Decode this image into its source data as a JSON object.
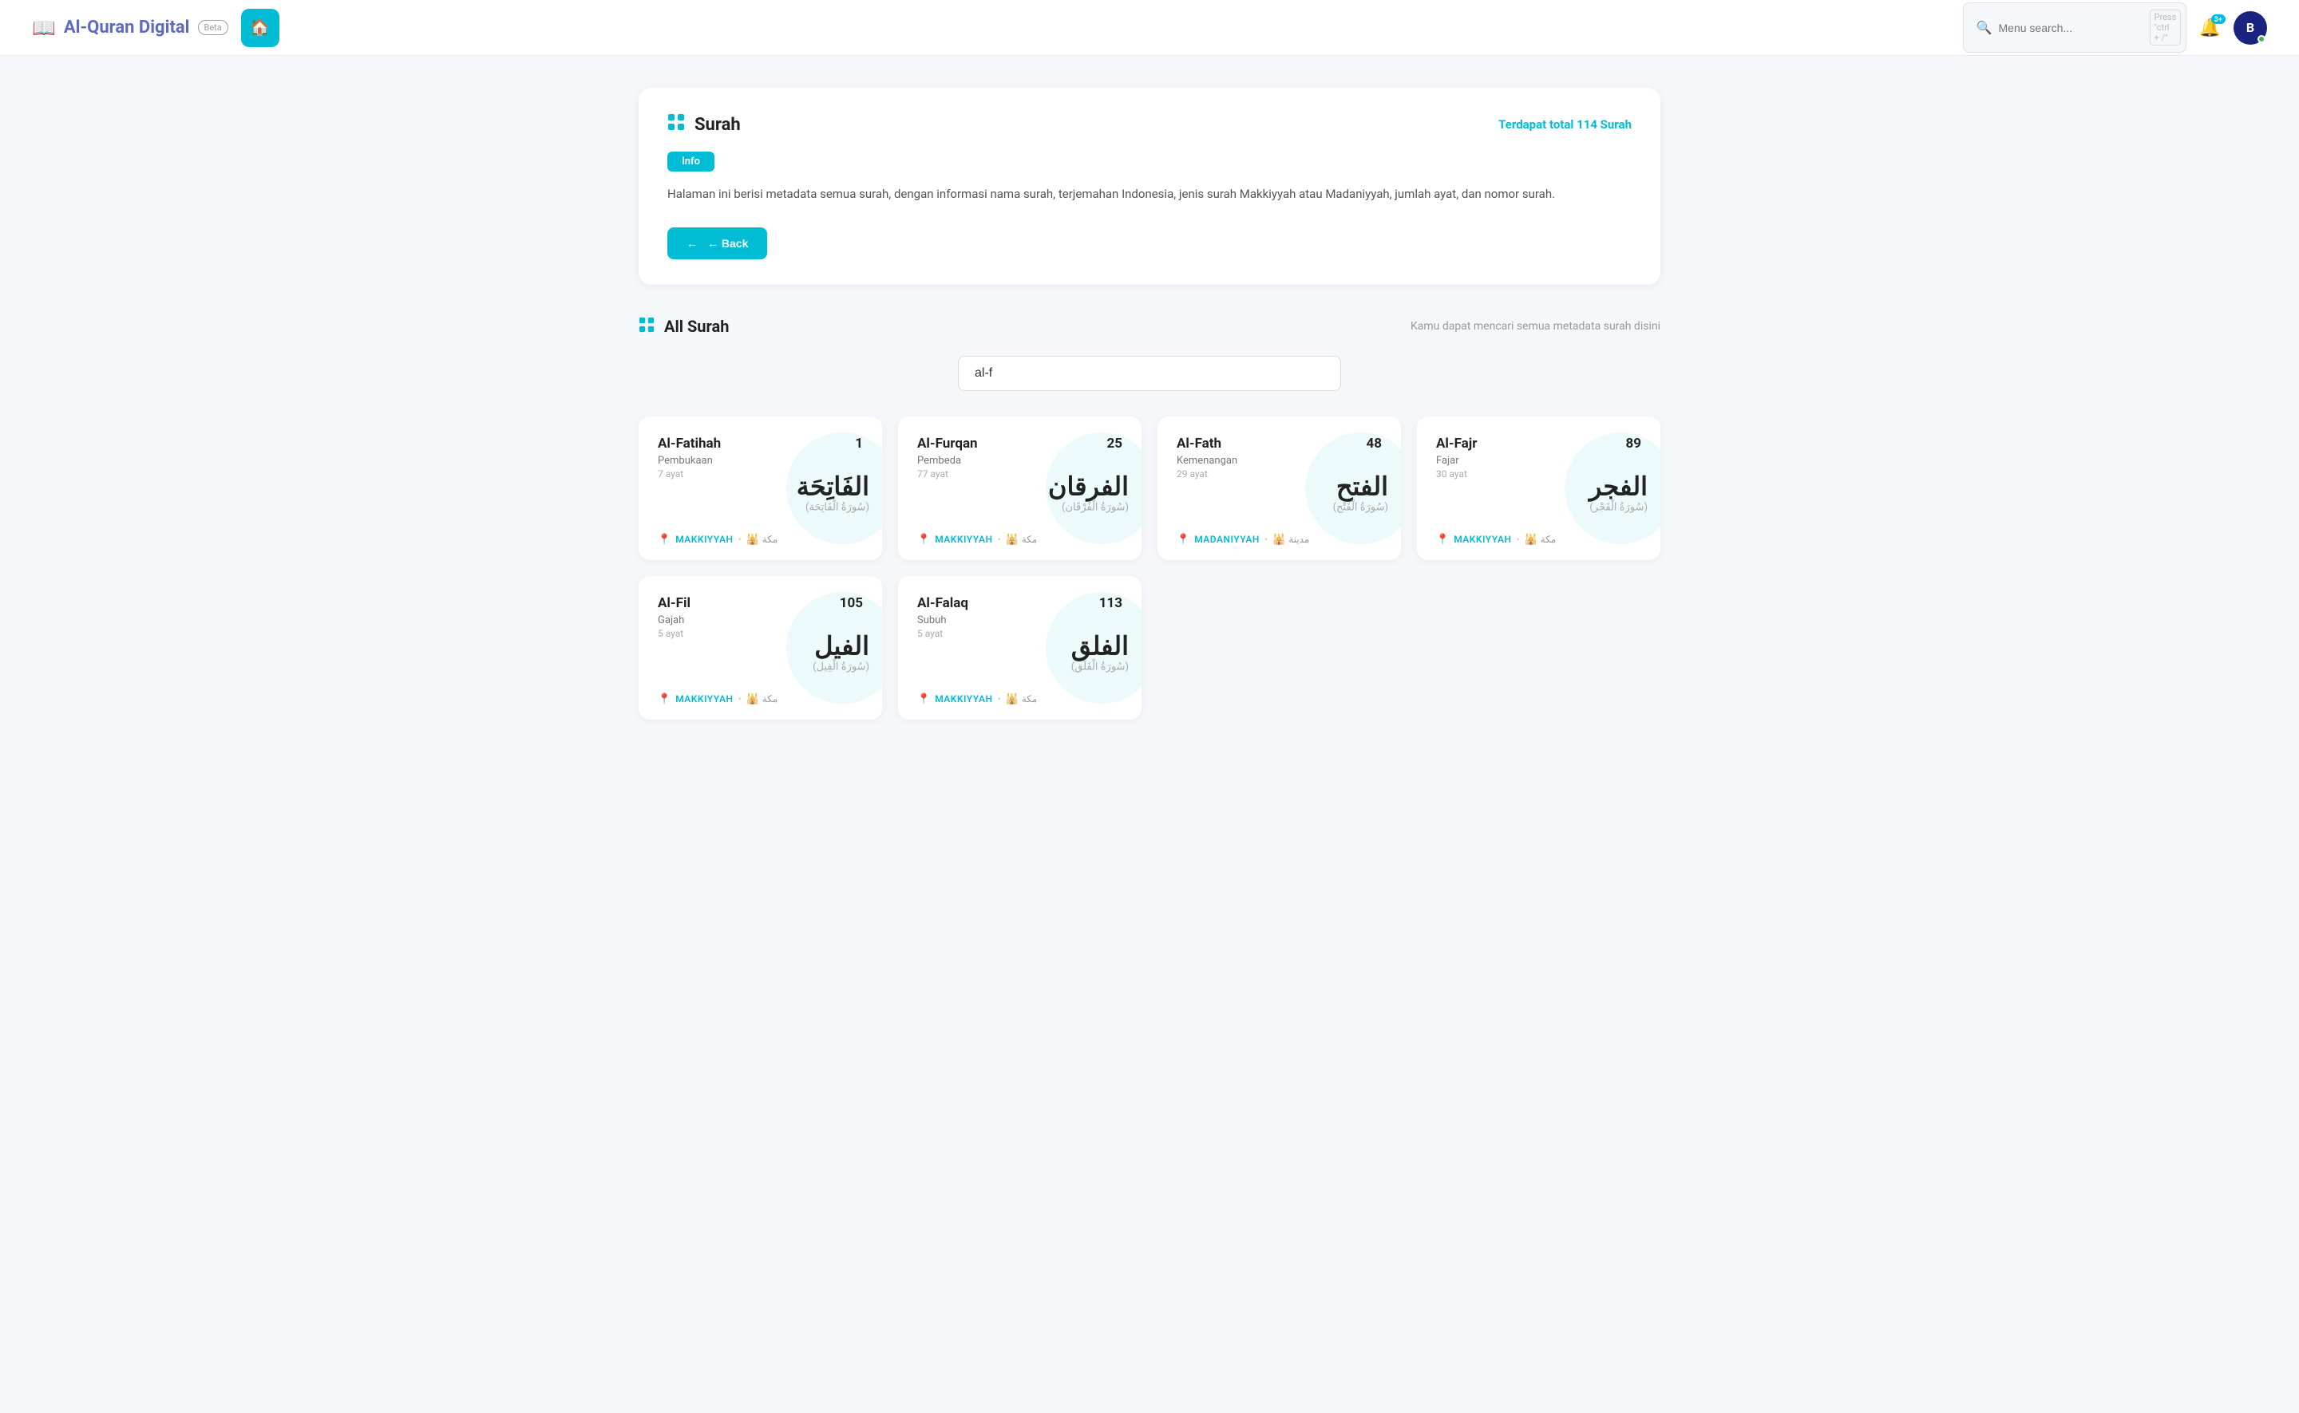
{
  "app": {
    "title": "Al-Quran Digital",
    "title_part1": "Al-Quran",
    "title_part2": " Digital",
    "beta_label": "Beta",
    "home_icon": "🏠",
    "search_placeholder": "Menu search...",
    "search_shortcut": "Press \"ctrl + /\"",
    "notif_badge": "3+",
    "avatar_label": "B"
  },
  "info_card": {
    "icon": "⊞",
    "title": "Surah",
    "total_text": "Terdapat total",
    "total_count": "114",
    "total_unit": "Surah",
    "info_badge": "Info",
    "description": "Halaman ini berisi metadata semua surah, dengan informasi nama surah, terjemahan Indonesia, jenis surah Makkiyyah atau Madaniyyah, jumlah ayat, dan nomor surah.",
    "back_label": "← Back"
  },
  "all_surah": {
    "icon": "⊞",
    "title": "All Surah",
    "hint": "Kamu dapat mencari semua metadata surah disini",
    "search_value": "al-f",
    "search_placeholder": "al-f"
  },
  "surahs": [
    {
      "name_en": "Al-Fatihah",
      "translation": "Pembukaan",
      "ayat": "7 ayat",
      "number": "1",
      "arabic_main": "الفَاتِحَة",
      "arabic_sub": "(سُورَةُ الْفَاتِحَة)",
      "type": "MAKKIYYAH",
      "city": "مكة",
      "city_type": "mecca"
    },
    {
      "name_en": "Al-Furqan",
      "translation": "Pembeda",
      "ayat": "77 ayat",
      "number": "25",
      "arabic_main": "الفرقان",
      "arabic_sub": "(سُورَةُ الْفُرْقَان)",
      "type": "MAKKIYYAH",
      "city": "مكة",
      "city_type": "mecca"
    },
    {
      "name_en": "Al-Fath",
      "translation": "Kemenangan",
      "ayat": "29 ayat",
      "number": "48",
      "arabic_main": "الفتح",
      "arabic_sub": "(سُورَةُ الْفَتْح)",
      "type": "MADANIYYAH",
      "city": "مدينة",
      "city_type": "medina"
    },
    {
      "name_en": "Al-Fajr",
      "translation": "Fajar",
      "ayat": "30 ayat",
      "number": "89",
      "arabic_main": "الفجر",
      "arabic_sub": "(سُورَةُ الْفَجْر)",
      "type": "MAKKIYYAH",
      "city": "مكة",
      "city_type": "mecca"
    },
    {
      "name_en": "Al-Fil",
      "translation": "Gajah",
      "ayat": "5 ayat",
      "number": "105",
      "arabic_main": "الفيل",
      "arabic_sub": "(سُورَةُ الْفِيل)",
      "type": "MAKKIYYAH",
      "city": "مكة",
      "city_type": "mecca"
    },
    {
      "name_en": "Al-Falaq",
      "translation": "Subuh",
      "ayat": "5 ayat",
      "number": "113",
      "arabic_main": "الفلق",
      "arabic_sub": "(سُورَةُ الْفَلَق)",
      "type": "MAKKIYYAH",
      "city": "مكة",
      "city_type": "mecca"
    }
  ]
}
